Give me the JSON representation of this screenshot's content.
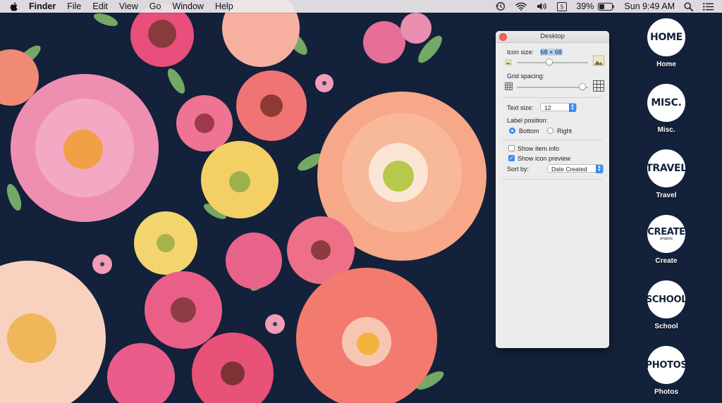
{
  "menubar": {
    "apple_icon": "apple-logo",
    "app_name": "Finder",
    "menus": [
      "File",
      "Edit",
      "View",
      "Go",
      "Window",
      "Help"
    ],
    "status": {
      "time_machine_icon": "time-machine-icon",
      "wifi_icon": "wifi-icon",
      "volume_icon": "volume-icon",
      "keyboard_icon": "input-source-icon",
      "battery_percent": "39%",
      "clock": "Sun 9:49 AM",
      "search_icon": "spotlight-icon",
      "menu_icon": "notification-center-icon"
    }
  },
  "panel": {
    "title": "Desktop",
    "icon_size_label": "Icon size:",
    "icon_size_value": "68 × 68",
    "icon_size_level": 0.45,
    "grid_spacing_label": "Grid spacing:",
    "grid_spacing_level": 0.97,
    "text_size_label": "Text size:",
    "text_size_value": "12",
    "label_position_label": "Label position:",
    "label_bottom": "Bottom",
    "label_right": "Right",
    "label_position_selected": "Bottom",
    "show_item_info": "Show item info",
    "show_item_info_checked": false,
    "show_icon_preview": "Show icon preview",
    "show_icon_preview_checked": true,
    "sort_by_label": "Sort by:",
    "sort_by_value": "Date Created"
  },
  "desktop_icons": [
    {
      "circle": "HOME",
      "sub": "",
      "label": "Home"
    },
    {
      "circle": "MISC.",
      "sub": "",
      "label": "Misc."
    },
    {
      "circle": "TRAVEL",
      "sub": "",
      "label": "Travel"
    },
    {
      "circle": "CREATE",
      "sub": "projects",
      "label": "Create"
    },
    {
      "circle": "SCHOOL",
      "sub": "",
      "label": "School"
    },
    {
      "circle": "PHOTOS",
      "sub": "",
      "label": "Photos"
    }
  ],
  "colors": {
    "wallpaper_bg": "#13213a",
    "accent_blue": "#3b8cf3",
    "close_red": "#fc605b"
  }
}
